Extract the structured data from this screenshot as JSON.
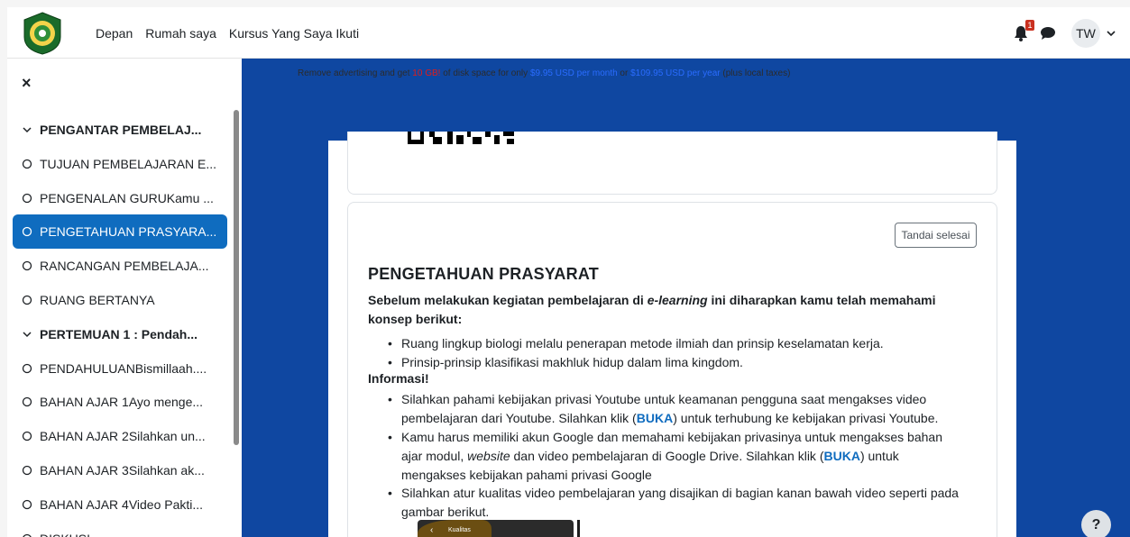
{
  "navbar": {
    "links": [
      "Depan",
      "Rumah saya",
      "Kursus Yang Saya Ikuti"
    ],
    "notification_count": "1",
    "user_initials": "TW"
  },
  "sidebar": {
    "close_label": "×",
    "items": [
      {
        "label": "PENGANTAR PEMBELAJ...",
        "type": "section"
      },
      {
        "label": "TUJUAN PEMBELAJARAN E...",
        "type": "item"
      },
      {
        "label": "PENGENALAN GURUKamu ...",
        "type": "item"
      },
      {
        "label": "PENGETAHUAN PRASYARA...",
        "type": "item",
        "active": true
      },
      {
        "label": "RANCANGAN PEMBELAJA...",
        "type": "item"
      },
      {
        "label": "RUANG BERTANYA",
        "type": "item"
      },
      {
        "label": "PERTEMUAN 1 : Pendah...",
        "type": "section"
      },
      {
        "label": "PENDAHULUANBismillaah....",
        "type": "item"
      },
      {
        "label": "BAHAN AJAR 1Ayo menge...",
        "type": "item"
      },
      {
        "label": "BAHAN AJAR 2Silahkan un...",
        "type": "item"
      },
      {
        "label": "BAHAN AJAR 3Silahkan ak...",
        "type": "item"
      },
      {
        "label": "BAHAN AJAR 4Video Pakti...",
        "type": "item"
      },
      {
        "label": "DISKUSI",
        "type": "item"
      }
    ]
  },
  "ad": {
    "part1": "Remove advertising and get ",
    "highlight1": "10 GB!",
    "part2": " of disk space for only ",
    "price_month": "$9.95 USD per month",
    "part3": " or ",
    "price_year": "$109.95 USD per year",
    "part4": " (plus local taxes)"
  },
  "activity": {
    "mark_done": "Tandai selesai",
    "title": "PENGETAHUAN PRASYARAT",
    "intro_a": "Sebelum melakukan kegiatan pembelajaran di ",
    "intro_em": "e-learning",
    "intro_b": " ini diharapkan kamu telah memahami konsep berikut:",
    "bullet1": "Ruang lingkup biologi melalu penerapan metode ilmiah dan prinsip keselamatan kerja.",
    "bullet2": "Prinsip-prinsip klasifikasi makhluk hidup dalam lima kingdom.",
    "info_heading": "Informasi!",
    "info1_a": "Silahkan pahami kebijakan privasi Youtube untuk keamanan pengguna saat mengakses video pembelajaran dari Youtube. Silahkan klik (",
    "info1_link": "BUKA",
    "info1_b": ") untuk terhubung ke kebijakan privasi Youtube.",
    "info2_a": "Kamu harus memiliki akun Google dan memahami kebijakan privasinya untuk mengakses bahan ajar modul, ",
    "info2_em": "website",
    "info2_b": " dan video pembelajaran  di  Google Drive. Silahkan klik (",
    "info2_link": "BUKA",
    "info2_c": ") untuk mengakses kebijakan pahami privasi Google",
    "info3": "Silahkan atur kualitas video pembelajaran yang disajikan di bagian kanan bawah  video seperti pada gambar berikut.",
    "thumb_label": "Kualitas"
  },
  "help_label": "?"
}
